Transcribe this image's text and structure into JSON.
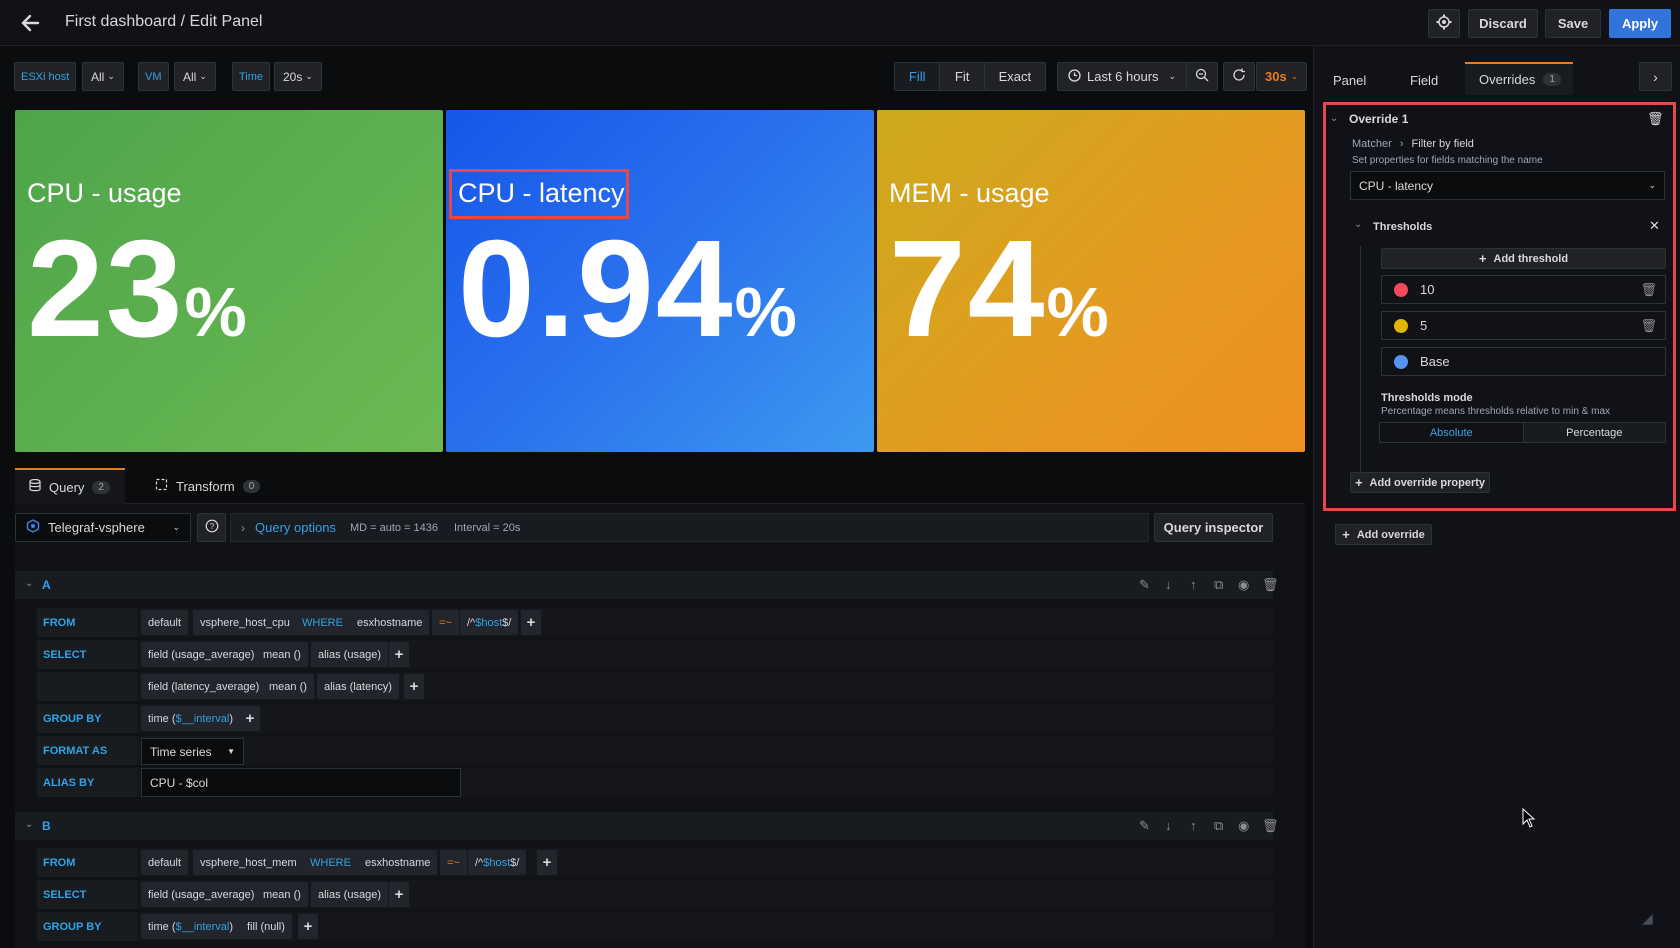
{
  "header": {
    "title": "First dashboard / Edit Panel",
    "discard": "Discard",
    "save": "Save",
    "apply": "Apply"
  },
  "variables": {
    "esxi_label": "ESXi host",
    "esxi_value": "All",
    "vm_label": "VM",
    "vm_value": "All",
    "time_label": "Time",
    "time_value": "20s"
  },
  "view_modes": [
    "Fill",
    "Fit",
    "Exact"
  ],
  "time_picker": {
    "range": "Last 6 hours",
    "refresh": "30s"
  },
  "stats": [
    {
      "title": "CPU - usage",
      "value": "23",
      "unit": "%"
    },
    {
      "title": "CPU - latency",
      "value": "0.94",
      "unit": "%"
    },
    {
      "title": "MEM - usage",
      "value": "74",
      "unit": "%"
    }
  ],
  "editor_tabs": {
    "query_label": "Query",
    "query_count": "2",
    "transform_label": "Transform",
    "transform_count": "0"
  },
  "query_bar": {
    "datasource": "Telegraf-vsphere",
    "query_options": "Query options",
    "md": "MD = auto = 1436",
    "interval": "Interval = 20s",
    "inspector": "Query inspector"
  },
  "query_a": {
    "ref": "A",
    "kw_from": "FROM",
    "kw_select": "SELECT",
    "kw_group": "GROUP BY",
    "kw_format": "FORMAT AS",
    "kw_alias": "ALIAS BY",
    "policy": "default",
    "measurement": "vsphere_host_cpu",
    "where": "WHERE",
    "tag": "esxhostname",
    "op": "=~",
    "regex_pre": "/^",
    "regex_var": "$host",
    "regex_post": "$/",
    "field1": "field (usage_average)",
    "mean": "mean ()",
    "alias1": "alias (usage)",
    "field2": "field (latency_average)",
    "alias2": "alias (latency)",
    "time_pre": "time (",
    "time_var": "$__interval",
    "time_post": ")",
    "format": "Time series",
    "alias_by": "CPU - $col"
  },
  "query_b": {
    "ref": "B",
    "policy": "default",
    "measurement": "vsphere_host_mem",
    "where": "WHERE",
    "tag": "esxhostname",
    "op": "=~",
    "regex_pre": "/^",
    "regex_var": "$host",
    "regex_post": "$/",
    "field1": "field (usage_average)",
    "mean": "mean ()",
    "alias1": "alias (usage)",
    "time_pre": "time (",
    "time_var": "$__interval",
    "time_post": ")",
    "fill": "fill (null)"
  },
  "side_tabs": {
    "panel": "Panel",
    "field": "Field",
    "overrides": "Overrides",
    "overrides_count": "1"
  },
  "override": {
    "title": "Override 1",
    "matcher": "Matcher",
    "filter": "Filter by field",
    "desc": "Set properties for fields matching the name",
    "selected": "CPU - latency",
    "thresholds_title": "Thresholds",
    "add_threshold": "Add threshold",
    "thresholds": [
      {
        "value": "10",
        "color": "#f2495c"
      },
      {
        "value": "5",
        "color": "#fade2a"
      },
      {
        "value": "Base",
        "color": "#5794f2"
      }
    ],
    "mode_title": "Thresholds mode",
    "mode_desc": "Percentage means thresholds relative to min & max",
    "mode_absolute": "Absolute",
    "mode_percentage": "Percentage",
    "add_property": "Add override property"
  },
  "add_override": "Add override",
  "colors": {
    "accent_blue": "#3274d9",
    "highlight_red": "#e8474a",
    "stat_green": "#5aa64b",
    "stat_blue": "#2a6ff0",
    "stat_orange": "#e6a01e"
  }
}
